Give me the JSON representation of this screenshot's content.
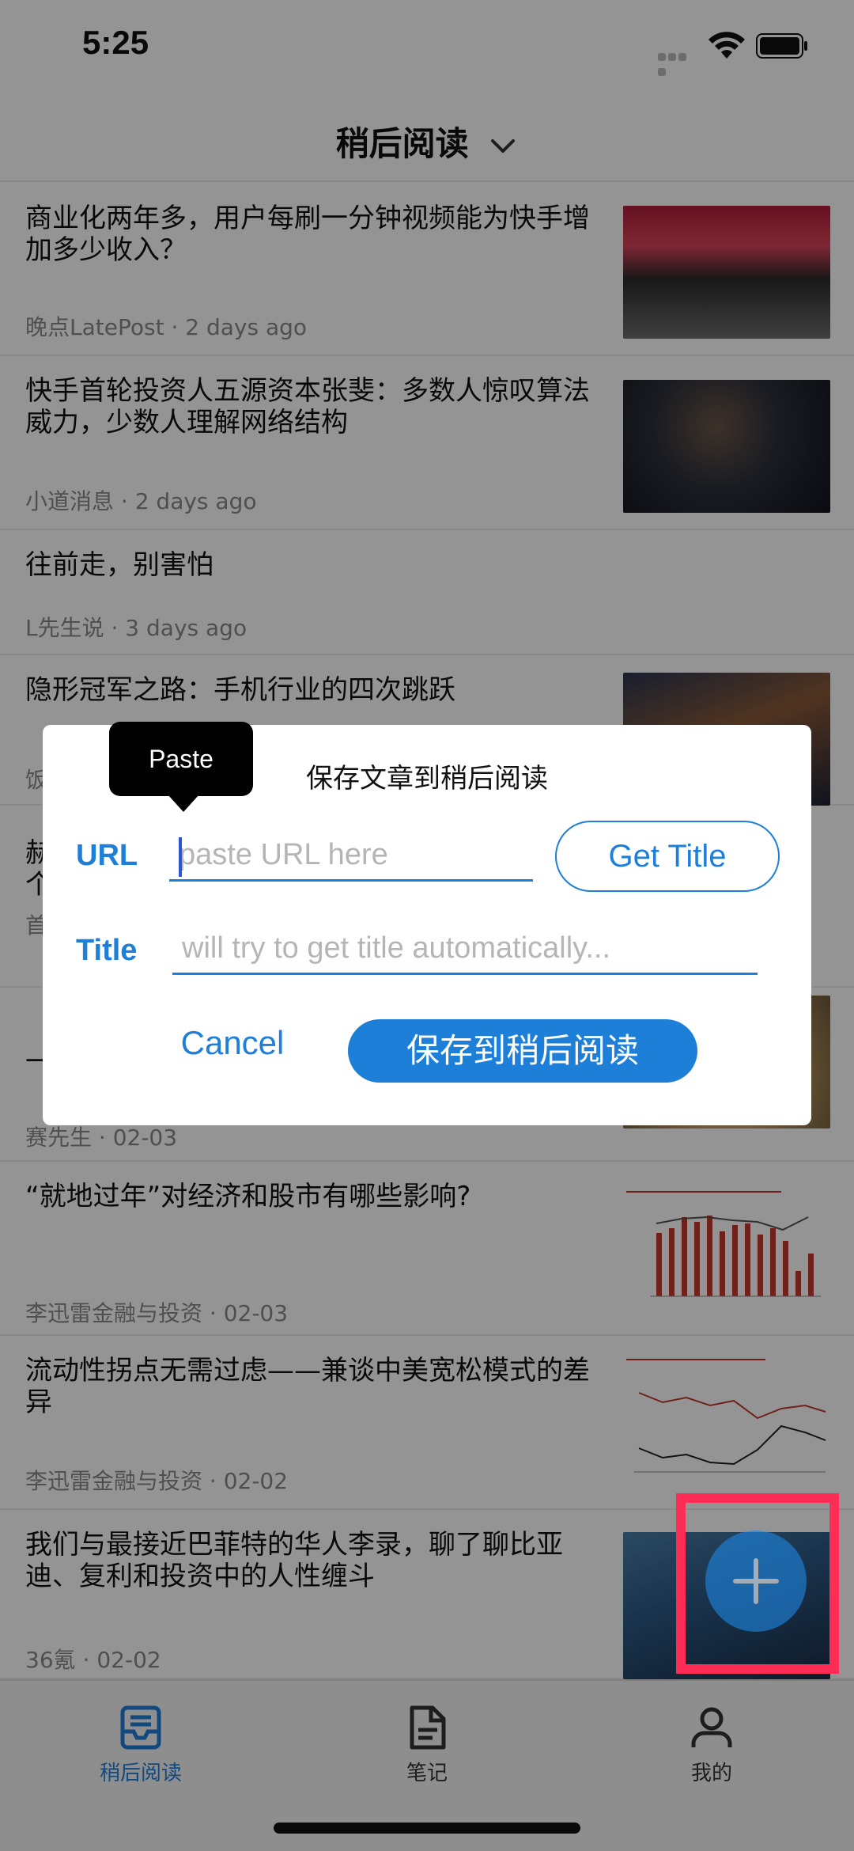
{
  "status_bar": {
    "time": "5:25"
  },
  "nav": {
    "title": "稍后阅读"
  },
  "articles": [
    {
      "title": "商业化两年多，用户每刷一分钟视频能为快手增加多少收入？",
      "meta": "晚点LatePost · 2 days ago",
      "thumbnail": "crowd-photo"
    },
    {
      "title": "快手首轮投资人五源资本张斐：多数人惊叹算法威力，少数人理解网络结构",
      "meta": "小道消息 · 2 days ago",
      "thumbnail": "person-photo"
    },
    {
      "title": "往前走，别害怕",
      "meta": "L先生说 · 3 days ago",
      "thumbnail": ""
    },
    {
      "title": "隐形冠军之路：手机行业的四次跳跃",
      "meta": "饭",
      "thumbnail": "landscape-photo"
    },
    {
      "title": "赫\n个",
      "meta": "首",
      "thumbnail": ""
    },
    {
      "title": "一",
      "meta": "赛先生 · 02-03",
      "thumbnail": "dish-photo"
    },
    {
      "title": "“就地过年”对经济和股市有哪些影响?",
      "meta": "李迅雷金融与投资 · 02-03",
      "thumbnail": "bar-chart-image"
    },
    {
      "title": "流动性拐点无需过虑——兼谈中美宽松模式的差异",
      "meta": "李迅雷金融与投资 · 02-02",
      "thumbnail": "line-chart-image"
    },
    {
      "title": "我们与最接近巴菲特的华人李录，聊了聊比亚迪、复利和投资中的人性缠斗",
      "meta": "36氪 · 02-02",
      "thumbnail": "person-photo"
    }
  ],
  "dialog": {
    "title": "保存文章到稍后阅读",
    "url_label": "URL",
    "url_placeholder": "paste URL here",
    "title_label": "Title",
    "title_placeholder": "will try to get title automatically...",
    "get_title_button": "Get Title",
    "cancel_button": "Cancel",
    "save_button": "保存到稍后阅读"
  },
  "tooltip": {
    "label": "Paste"
  },
  "tabs": [
    {
      "label": "稍后阅读",
      "icon": "inbox-icon",
      "active": true
    },
    {
      "label": "笔记",
      "icon": "document-icon",
      "active": false
    },
    {
      "label": "我的",
      "icon": "person-icon",
      "active": false
    }
  ],
  "colors": {
    "accent": "#1e7fd9",
    "highlight": "#ff2d55",
    "fab": "#1e88e5"
  }
}
